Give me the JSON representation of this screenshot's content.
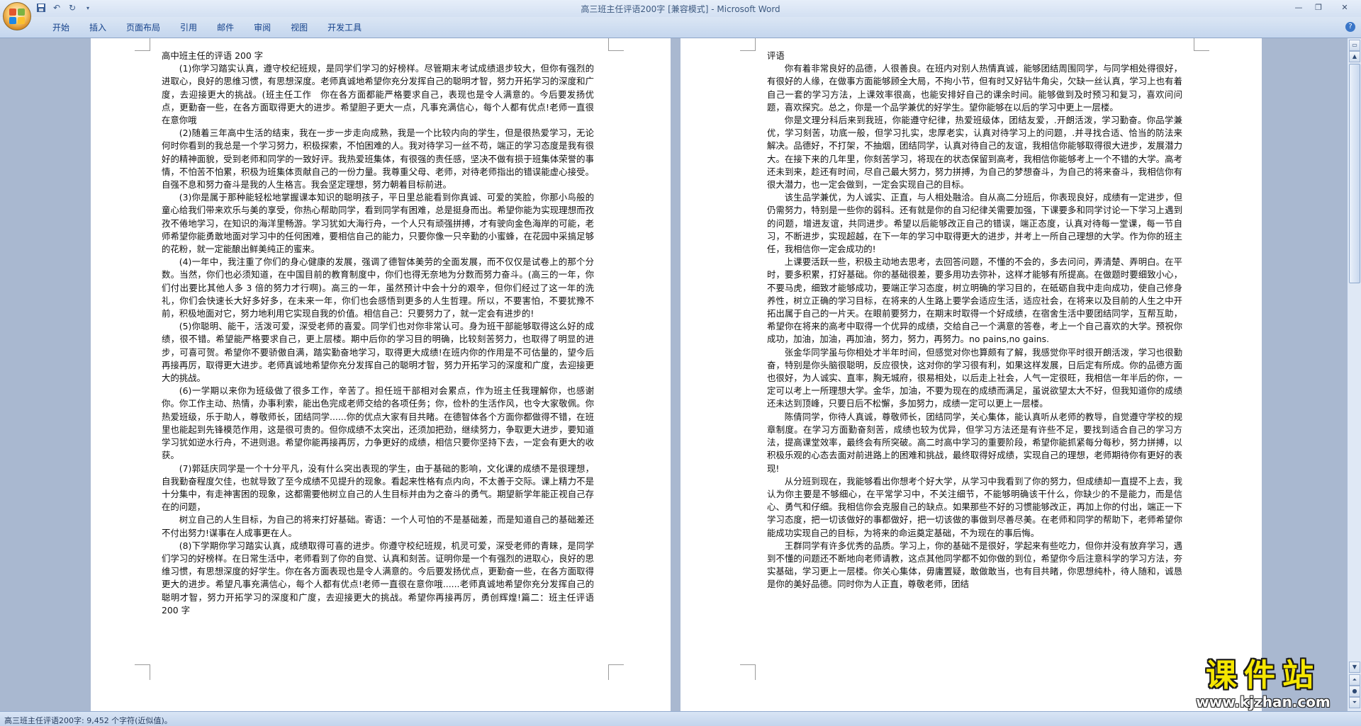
{
  "window": {
    "title": "高三班主任评语200字 [兼容模式] - Microsoft Word"
  },
  "qat": {
    "icons": [
      "save-icon",
      "undo-icon",
      "redo-icon",
      "customize-icon"
    ]
  },
  "ribbon": {
    "tabs": [
      "开始",
      "插入",
      "页面布局",
      "引用",
      "邮件",
      "审阅",
      "视图",
      "开发工具"
    ]
  },
  "left_page": {
    "heading": "高中班主任的评语 200 字",
    "paragraphs": [
      "(1)你学习踏实认真，遵守校纪班规，是同学们学习的好榜样。尽管期末考试成绩退步较大，但你有强烈的进取心，良好的思维习惯，有思想深度。老师真诚地希望你充分发挥自己的聪明才智，努力开拓学习的深度和广度，去迎接更大的挑战。(班主任工作　你在各方面都能严格要求自己，表现也是令人满意的。今后要发扬优点，更勤奋一些，在各方面取得更大的进步。希望胆子更大一点，凡事充满信心，每个人都有优点!老师一直很在意你哦",
      "(2)随着三年高中生活的结束，我在一步一步走向成熟，我是一个比较内向的学生，但是很热爱学习，无论何时你看到的我总是一个学习努力，积极探索，不怕困难的人。我对待学习一丝不苟，端正的学习态度是我有很好的精神面貌，受到老师和同学的一致好评。我热爱班集体，有很强的责任感，坚决不做有损于班集体荣誉的事情，不怕苦不怕累，积极为班集体贡献自己的一份力量。我尊重父母、老师，对待老师指出的错误能虚心接受。自强不息和努力奋斗是我的人生格言。我会坚定理想，努力朝着目标前进。",
      "(3)你是属于那种能轻松地掌握课本知识的聪明孩子，平日里总能看到你真诚、可爱的笑脸，你那小鸟般的童心给我们带来欢乐与美的享受，你热心帮助同学，看到同学有困难，总是挺身而出。希望你能为实现理想而孜孜不倦地学习，在知识的海洋里畅游。学习犹如大海行舟，一个人只有顽强拼搏，才有驶向金色海岸的可能，老师希望你能勇敢地面对学习中的任何困难，要相信自己的能力，只要你像一只辛勤的小蜜蜂，在花园中采搞足够的花粉，就一定能酿出鲜美纯正的蜜来。",
      "(4)一年中，我注重了你们的身心健康的发展，强调了德智体美劳的全面发展，而不仅仅是试卷上的那个分数。当然，你们也必须知道，在中国目前的教育制度中，你们也得无奈地为分数而努力奋斗。(高三的一年，你们付出要比其他人多 3 倍的努力才行啊)。高三的一年，虽然预计中会十分的艰辛，但你们经过了这一年的洗礼，你们会快速长大好多好多，在未来一年，你们也会感悟到更多的人生哲理。所以，不要害怕，不要犹豫不前，积极地面对它，努力地利用它实现自我的价值。相信自己：只要努力了，就一定会有进步的!",
      "(5)你聪明、能干，活泼可爱，深受老师的喜爱。同学们也对你非常认可。身为班干部能够取得这么好的成绩，很不错。希望能严格要求自己，更上层楼。期中后你的学习目的明确，比较刻苦努力，也取得了明显的进步，可喜可贺。希望你不要骄傲自满，踏实勤奋地学习，取得更大成绩!在班内你的作用是不可估量的，望今后再接再厉，取得更大进步。老师真诚地希望你充分发挥自己的聪明才智，努力开拓学习的深度和广度，去迎接更大的挑战。",
      "(6)一学期以来你为班级做了很多工作，辛苦了。担任班干部相对会累点，作为班主任我理解你，也感谢你。你工作主动、热情，办事利索，能出色完成老师交给的各项任务；你，俭朴的生活作风，也令大家敬佩。你热爱班级，乐于助人，尊敬师长，团结同学......你的优点大家有目共睹。在德智体各个方面你都做得不错，在班里也能起到先锋模范作用，这是很可贵的。但你成绩不太突出，还须加把劲，继续努力，争取更大进步，要知道学习犹如逆水行舟，不进则退。希望你能再接再厉，力争更好的成绩，相信只要你坚持下去，一定会有更大的收获。",
      "(7)郭廷庆同学是一个十分平凡，没有什么突出表现的学生，由于基础的影响，文化课的成绩不是很理想，自我勤奋程度欠佳，也就导致了至今成绩不见提升的现象。看起来性格有点内向，不太善于交际。课上精力不是十分集中，有走神害困的现象，这都需要他树立自己的人生目标并由为之奋斗的勇气。期望新学年能正视自己存在的问题，",
      "树立自己的人生目标，为自己的将来打好基础。寄语：一个人可怕的不是基础差，而是知道自己的基础差还不付出努力!谋事在人成事更在人。",
      "(8)下学期你学习踏实认真，成绩取得可喜的进步。你遵守校纪班规，机灵可爱，深受老师的青睐，是同学们学习的好榜样。在日常生活中，老师看到了你的自觉、认真和刻苦。证明你是一个有强烈的进取心，良好的思维习惯，有思想深度的好学生。你在各方面表现也是令人满意的。今后要发扬优点，更勤奋一些，在各方面取得更大的进步。希望凡事充满信心，每个人都有优点!老师一直很在意你哦......老师真诚地希望你充分发挥自己的聪明才智，努力开拓学习的深度和广度，去迎接更大的挑战。希望你再接再厉，勇创辉煌!篇二：班主任评语 200 字"
    ]
  },
  "right_page": {
    "heading": "评语",
    "paragraphs": [
      "你有着非常良好的品德，人很善良。在班内对别人热情真诚，能够团结周围同学，与同学相处得很好，有很好的人缘，在做事方面能够顾全大局，不拘小节，但有时又好钻牛角尖，欠缺一丝认真，学习上也有着自己一套的学习方法，上课效率很高，也能安排好自己的课余时间。能够做到及时预习和复习，喜欢问问题，喜欢探究。总之，你是一个品学兼优的好学生。望你能够在以后的学习中更上一层楼。",
      "你是文理分科后来到我班，你能遵守纪律，热爱班级体，团结友爱，.开朗活泼，学习勤奋。你品学兼优，学习刻苦，功底一般，但学习扎实，忠厚老实，认真对待学习上的问题，.并寻找合适、恰当的防法来解决。品德好，不打架，不抽烟，团结同学，认真对待自己的友谊，我相信你能够取得很大进步，发展潜力大。在接下来的几年里，你刻苦学习，将现在的状态保留到高考，我相信你能够考上一个不错的大学。高考还未到来，趁还有时间，尽自己最大努力，努力拼搏，为自己的梦想奋斗，为自己的将来奋斗，我相信你有很大潜力，也一定会做到，一定会实现自己的目标。",
      "该生品学兼优，为人诚实、正直，与人相处融洽。自从高二分班后，你表现良好，成绩有一定进步，但仍需努力，特别是一些你的弱科。还有就是你的自习纪律关需要加强，下课要多和同学讨论一下学习上遇到的问题，增进友谊，共同进步。希望以后能够改正自己的错误，端正态度，认真对待每一堂课，每一节自习，不断进步，实现超越，在下一年的学习中取得更大的进步，并考上一所自己理想的大学。作为你的班主任，我相信你一定会成功的!",
      "上课要活跃一些，积极主动地去思考，去回答问题，不懂的不会的，多去问问，弄清楚、弄明白。在平时，要多积累，打好基础。你的基础很差，要多用功去弥补，这样才能够有所提高。在做题时要细致小心，不要马虎，细致才能够成功，要端正学习态度，树立明确的学习目的，在砥砺自我中走向成功，使自己修身养性，树立正确的学习目标，在将来的人生路上要学会适应生活，适应社会，在将来以及目前的人生之中开拓出属于自己的一片天。在眼前要努力，在期末时取得一个好成绩，在宿舍生活中要团结同学，互帮互助，希望你在将来的高考中取得一个优异的成绩，交给自己一个满意的答卷，考上一个自己喜欢的大学。预祝你成功，加油，加油，再加油，努力，努力，再努力。no pains,no gains.",
      "张金华同学虽与你相处才半年时间，但感觉对你也算颇有了解，我感觉你平时很开朗活泼，学习也很勤奋，特别是你头脑很聪明，反应很快，这对你的学习很有利，如果这样发展，日后定有所成。你的品德方面也很好，为人诚实、直率，胸无城府，很易相处，以后走上社会，人气一定很旺，我相信一年半后的你，一定可以考上一所理想大学。金华，加油，不要为现在的成绩而满足，虽说欲望太大不好，但我知道你的成绩还未达到顶峰，只要日后不松懈，多加努力，成绩一定可以更上一层楼。",
      "陈倩同学，你待人真诚，尊敬师长，团结同学，关心集体，能认真听从老师的教导，自觉遵守学校的规章制度。在学习方面勤奋刻苦，成绩也较为优异，但学习方法还是有许些不足，要找到适合自己的学习方法，提高课堂效率，最终会有所突破。高二时高中学习的重要阶段，希望你能抓紧每分每秒，努力拼搏，以积极乐观的心态去面对前进路上的困难和挑战，最终取得好成绩，实现自己的理想，老师期待你有更好的表现!",
      "从分班到现在，我能够看出你想考个好大学，从学习中我看到了你的努力，但成绩却一直提不上去，我认为你主要是不够细心，在平常学习中，不关注细节，不能够明确该干什么，你缺少的不是能力，而是信心、勇气和仔细。我相信你会克服自己的缺点。如果那些不好的习惯能够改正，再加上你的付出，端正一下学习态度，把一切该做好的事都做好，把一切该做的事做到尽善尽美。在老师和同学的帮助下，老师希望你能成功实现自己的目标，为将来的命运奠定基础，不为现在的事后悔。",
      "王群同学有许多优秀的品质。学习上，你的基础不是很好，学起来有些吃力，但你并没有放弃学习，遇到不懂的问题还不断地向老师请教，这点其他同学都不如你做的到位，希望你今后注意科学的学习方法，夯实基础，学习更上一层楼。你关心集体，毋庸置疑，敢做敢当，也有目共睹，你思想纯朴，待人随和，诚恳是你的美好品德。同时你为人正直，尊敬老师，团结"
    ]
  },
  "status": {
    "text": "高三班主任评语200字: 9,452 个字符(近似值)。"
  },
  "watermark": {
    "brand": "课件站",
    "url": "www.kjzhan.com"
  }
}
